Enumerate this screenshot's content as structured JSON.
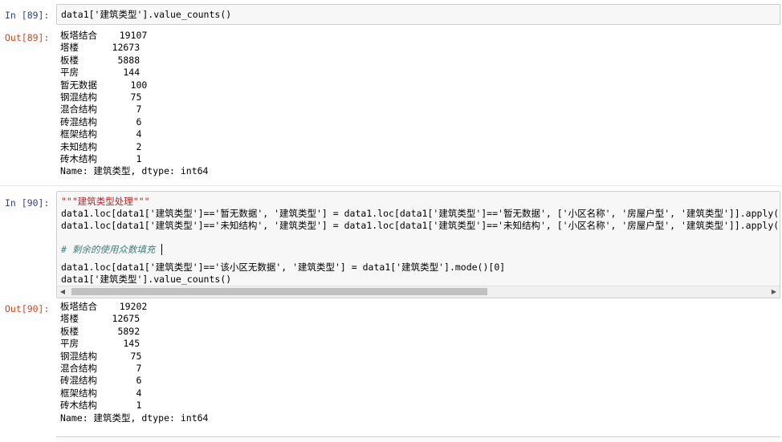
{
  "cells": {
    "in89": {
      "prompt": "In  [89]:",
      "code": "data1['建筑类型'].value_counts()"
    },
    "out89": {
      "prompt": "Out[89]:",
      "lines": [
        "板塔结合    19107",
        "塔楼      12673",
        "板楼       5888",
        "平房        144",
        "暂无数据      100",
        "钢混结构      75",
        "混合结构       7",
        "砖混结构       6",
        "框架结构       4",
        "未知结构       2",
        "砖木结构       1",
        "Name: 建筑类型, dtype: int64"
      ]
    },
    "in90": {
      "prompt": "In  [90]:",
      "lines": [
        "\"\"\"建筑类型处理\"\"\"",
        "data1.loc[data1['建筑类型']=='暂无数据', '建筑类型'] = data1.loc[data1['建筑类型']=='暂无数据', ['小区名称', '房屋户型', '建筑类型']].apply(lam",
        "data1.loc[data1['建筑类型']=='未知结构', '建筑类型'] = data1.loc[data1['建筑类型']=='未知结构', ['小区名称', '房屋户型', '建筑类型']].apply(lam",
        "",
        "# 剩余的使用众数填充",
        "data1.loc[data1['建筑类型']=='该小区无数据', '建筑类型'] = data1['建筑类型'].mode()[0]",
        "data1['建筑类型'].value_counts()"
      ]
    },
    "out90": {
      "prompt": "Out[90]:",
      "lines": [
        "板塔结合    19202",
        "塔楼      12675",
        "板楼       5892",
        "平房        145",
        "钢混结构      75",
        "混合结构       7",
        "砖混结构       6",
        "框架结构       4",
        "砖木结构       1",
        "Name: 建筑类型, dtype: int64"
      ]
    }
  },
  "scrollbar": {
    "left_arrow": "◀",
    "right_arrow": "▶"
  }
}
